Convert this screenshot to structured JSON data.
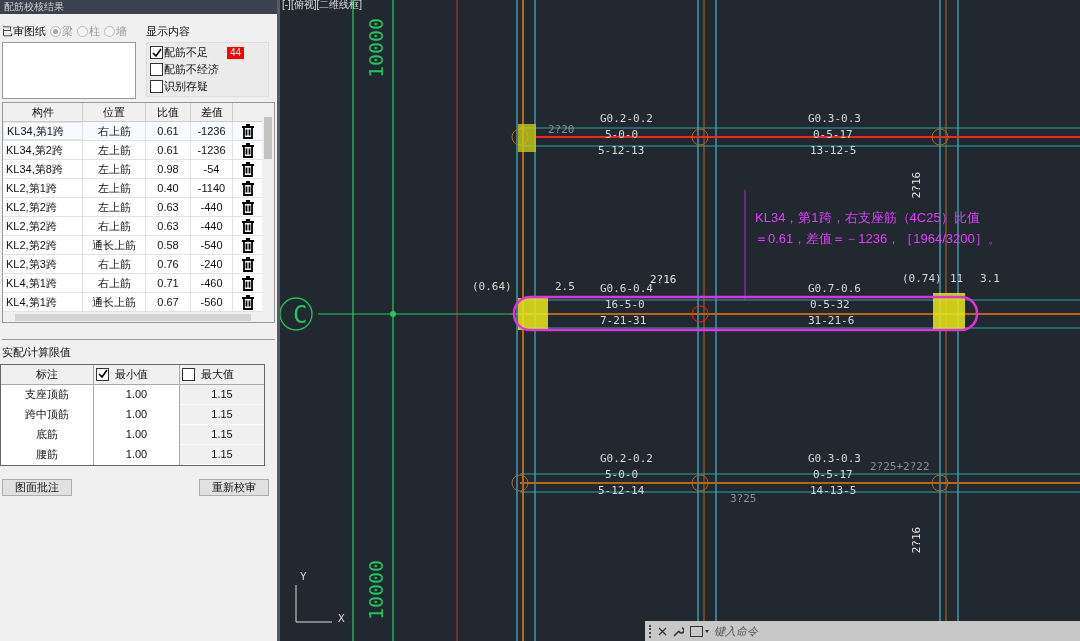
{
  "panel": {
    "title": "配筋校核结果",
    "drawings": {
      "label": "已审图纸",
      "options": [
        {
          "label": "梁",
          "selected": true,
          "disabled": true
        },
        {
          "label": "柱",
          "selected": false,
          "disabled": true
        },
        {
          "label": "墙",
          "selected": false,
          "disabled": true
        }
      ]
    },
    "display": {
      "label": "显示内容",
      "options": [
        {
          "label": "配筋不足",
          "checked": true,
          "badge": "44"
        },
        {
          "label": "配筋不经济",
          "checked": false
        },
        {
          "label": "识别存疑",
          "checked": false
        }
      ]
    },
    "results": {
      "columns": [
        "构件",
        "位置",
        "比值",
        "差值"
      ],
      "rows": [
        {
          "cells": [
            "KL34,第1跨",
            "右上筋",
            "0.61",
            "-1236"
          ],
          "selected": true
        },
        {
          "cells": [
            "KL34,第2跨",
            "左上筋",
            "0.61",
            "-1236"
          ],
          "selected": false
        },
        {
          "cells": [
            "KL34,第8跨",
            "左上筋",
            "0.98",
            "-54"
          ],
          "selected": false
        },
        {
          "cells": [
            "KL2,第1跨",
            "左上筋",
            "0.40",
            "-1140"
          ],
          "selected": false
        },
        {
          "cells": [
            "KL2,第2跨",
            "左上筋",
            "0.63",
            "-440"
          ],
          "selected": false
        },
        {
          "cells": [
            "KL2,第2跨",
            "右上筋",
            "0.63",
            "-440"
          ],
          "selected": false
        },
        {
          "cells": [
            "KL2,第2跨",
            "通长上筋",
            "0.58",
            "-540"
          ],
          "selected": false
        },
        {
          "cells": [
            "KL2,第3跨",
            "右上筋",
            "0.76",
            "-240"
          ],
          "selected": false
        },
        {
          "cells": [
            "KL4,第1跨",
            "右上筋",
            "0.71",
            "-460"
          ],
          "selected": false
        },
        {
          "cells": [
            "KL4,第1跨",
            "通长上筋",
            "0.67",
            "-560"
          ],
          "selected": false
        }
      ]
    },
    "limits": {
      "title": "实配/计算限值",
      "header": {
        "label": "标注",
        "min": {
          "label": "最小值",
          "checked": true
        },
        "max": {
          "label": "最大值",
          "checked": false
        }
      },
      "rows": [
        {
          "label": "支座顶筋",
          "min": "1.00",
          "max": "1.15"
        },
        {
          "label": "跨中顶筋",
          "min": "1.00",
          "max": "1.15"
        },
        {
          "label": "底筋",
          "min": "1.00",
          "max": "1.15"
        },
        {
          "label": "腰筋",
          "min": "1.00",
          "max": "1.15"
        }
      ]
    },
    "buttons": [
      "图面批注",
      "重新校审"
    ]
  },
  "cad": {
    "viewport_label": "[-][俯视][二维线框]",
    "labels": [
      "10000",
      "10000",
      "C",
      "2?20",
      "G0.2-0.2",
      "5-0-0",
      "5-12-13",
      "G0.3-0.3",
      "0-5-17",
      "13-12-5",
      "2?16",
      "G0.6-0.4",
      "16-5-0",
      "7-21-31",
      "G0.7-0.6",
      "0-5-32",
      "31-21-6",
      "(0.64)",
      "2.5",
      "(0.74)",
      "11",
      "3.1",
      "2?16",
      "G0.2-0.2",
      "5-0-0",
      "5-12-14",
      "G0.3-0.3",
      "0-5-17",
      "14-13-5",
      "2?25+2?22",
      "3?25",
      "2?16",
      "Y",
      "X"
    ],
    "note": [
      "KL34，第1跨，右支座筋（4C25）比值",
      "＝0.61，差值＝－1236，［1964/3200］。"
    ],
    "command": {
      "placeholder": "键入命令"
    }
  }
}
